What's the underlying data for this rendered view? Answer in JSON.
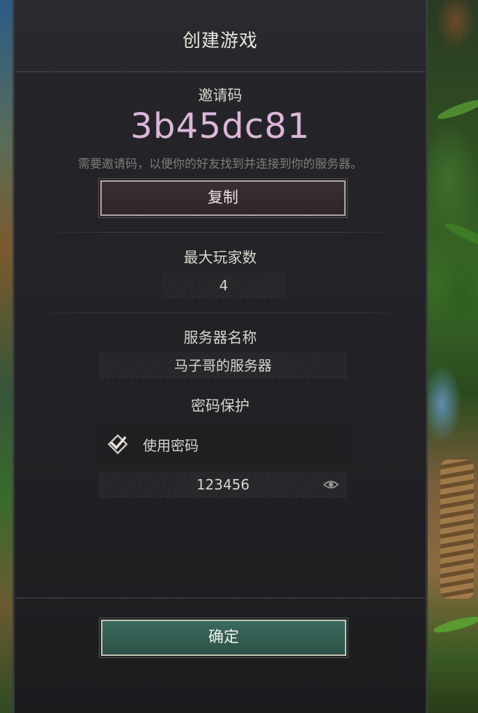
{
  "dialog": {
    "title": "创建游戏"
  },
  "invite": {
    "label": "邀请码",
    "code": "3b45dc81",
    "description": "需要邀请码，以便你的好友找到并连接到你的服务器。",
    "copy_label": "复制"
  },
  "max_players": {
    "label": "最大玩家数",
    "value": "4"
  },
  "server_name": {
    "label": "服务器名称",
    "value": "马子哥的服务器"
  },
  "password": {
    "label": "密码保护",
    "checkbox_label": "使用密码",
    "checked": true,
    "value": "123456",
    "reveal_icon": "eye-icon"
  },
  "confirm": {
    "label": "确定"
  },
  "colors": {
    "invite_code": "#dcb6da",
    "confirm_button": "#2f5a4d",
    "panel": "#232327"
  }
}
